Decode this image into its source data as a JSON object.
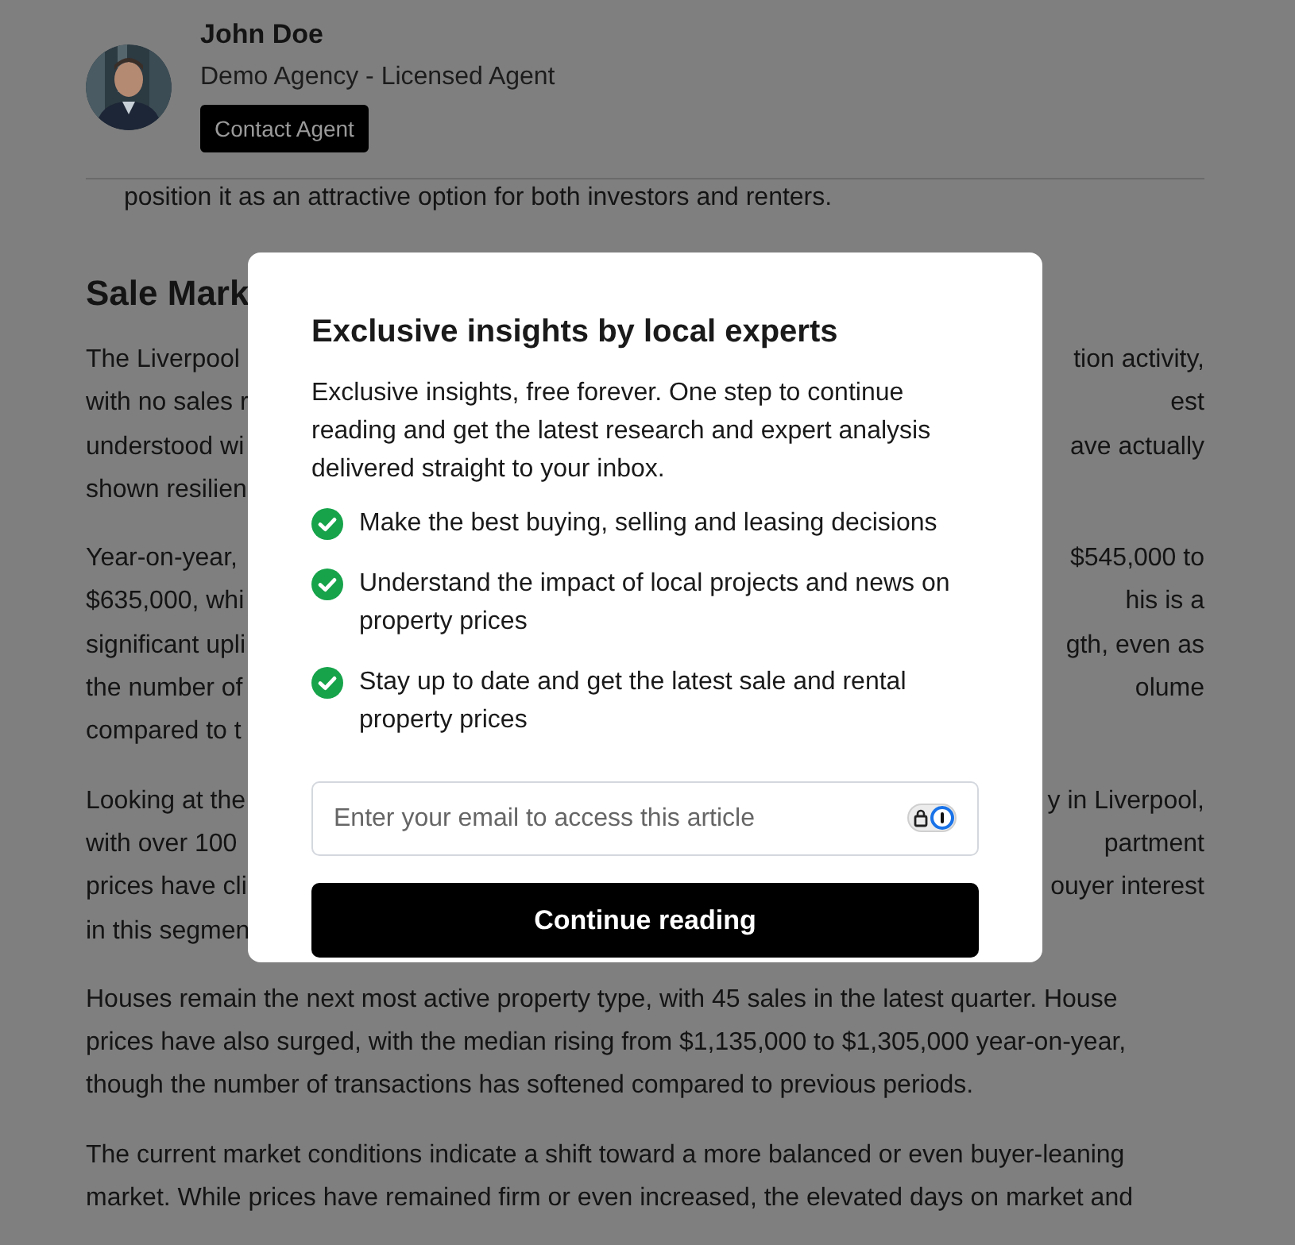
{
  "agent": {
    "kind": "picture",
    "name": "John Doe",
    "title": "Demo Agency - Licensed Agent",
    "contact_button": "Contact Agent"
  },
  "intro_line": "position it as an attractive option for both investors and renters.",
  "heading": "Sale Mark",
  "paragraphs": [
    {
      "lines": [
        {
          "left": "The Liverpool",
          "right": "tion activity,"
        },
        {
          "left": "with no sales r",
          "right": "est"
        },
        {
          "left": "understood wi",
          "right": "ave actually"
        },
        {
          "left": "shown resilien"
        }
      ]
    },
    {
      "lines": [
        {
          "left": "Year-on-year,",
          "right": "$545,000 to"
        },
        {
          "left": "$635,000, whi",
          "right": "his is a"
        },
        {
          "left": "significant upli",
          "right": "gth, even as"
        },
        {
          "left": "the number of",
          "right": "olume"
        },
        {
          "left": "compared to t"
        }
      ]
    },
    {
      "lines": [
        {
          "left": "Looking at the",
          "right": "y in Liverpool,"
        },
        {
          "left": "with over 100",
          "right": "partment"
        },
        {
          "left": "prices have cli",
          "right": "ouyer interest"
        },
        {
          "left": "in this segmen"
        }
      ]
    },
    {
      "lines": [
        {
          "left": "Houses remain the next most active property type, with 45 sales in the latest quarter. House"
        },
        {
          "left": "prices have also surged, with the median rising from $1,135,000 to $1,305,000 year-on-year,"
        },
        {
          "left": "though the number of transactions has softened compared to previous periods."
        }
      ]
    },
    {
      "lines": [
        {
          "left": "The current market conditions indicate a shift toward a more balanced or even buyer-leaning"
        },
        {
          "left": "market. While prices have remained firm or even increased, the elevated days on market and"
        }
      ]
    }
  ],
  "modal": {
    "title": "Exclusive insights by local experts",
    "description": "Exclusive insights, free forever. One step to continue reading and get the latest research and expert analysis delivered straight to your inbox.",
    "benefits": [
      {
        "text": "Make the best buying, selling and leasing decisions",
        "checked": true
      },
      {
        "text": "Understand the impact of local projects and news on property prices",
        "checked": true
      },
      {
        "text": "Stay up to date and get the latest sale and rental property prices",
        "checked": true
      }
    ],
    "email_field": {
      "placeholder": "Enter your email to access this article"
    },
    "submit_button": "Continue reading"
  }
}
